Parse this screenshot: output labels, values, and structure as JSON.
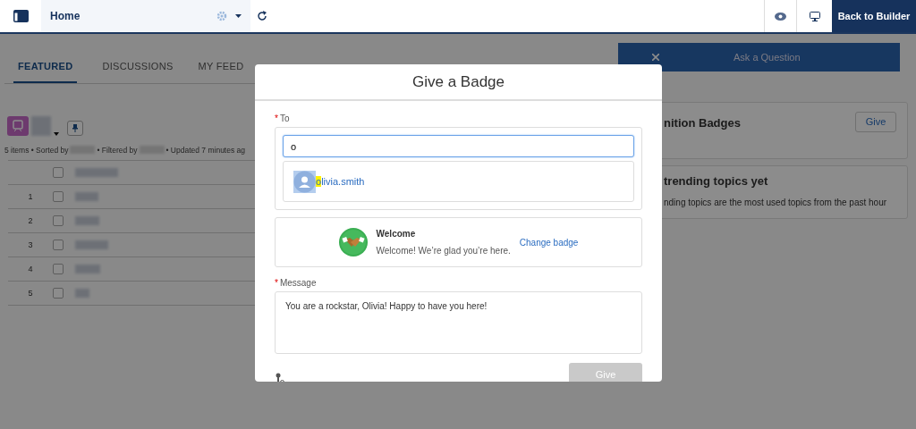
{
  "topbar": {
    "page_selector": "Home",
    "builder_button": "Back to Builder"
  },
  "tabs": [
    {
      "label": "FEATURED",
      "selected": true
    },
    {
      "label": "DISCUSSIONS",
      "selected": false
    },
    {
      "label": "MY FEED",
      "selected": false
    }
  ],
  "list_view": {
    "meta": [
      "5 items • Sorted by",
      "• Filtered by",
      "• Updated 7 minutes ag"
    ],
    "header_checked": false,
    "rows": [
      {
        "number": "1",
        "checked": false
      },
      {
        "number": "2",
        "checked": false
      },
      {
        "number": "3",
        "checked": false
      },
      {
        "number": "4",
        "checked": false
      },
      {
        "number": "5",
        "checked": false
      }
    ]
  },
  "sidebar": {
    "ask_button": "Ask a Question",
    "badges_card": {
      "title": "nition Badges",
      "button": "Give"
    },
    "trending_card": {
      "title": "trending topics yet",
      "text": "nding topics are the most used topics from the past hour"
    }
  },
  "modal": {
    "title": "Give a Badge",
    "required_mark": "*",
    "to_label": "To",
    "to_field": {
      "value": "o"
    },
    "suggestions": [
      {
        "name": "olivia.smith"
      }
    ],
    "badge": {
      "name": "Welcome",
      "description": "Welcome! We’re glad you’re here.",
      "change_link": "Change badge"
    },
    "message_label": "Message",
    "message": {
      "value": "You are a rockstar, Olivia! Happy to have you here!"
    },
    "give_button": {
      "label": "Give",
      "disabled": true
    }
  }
}
